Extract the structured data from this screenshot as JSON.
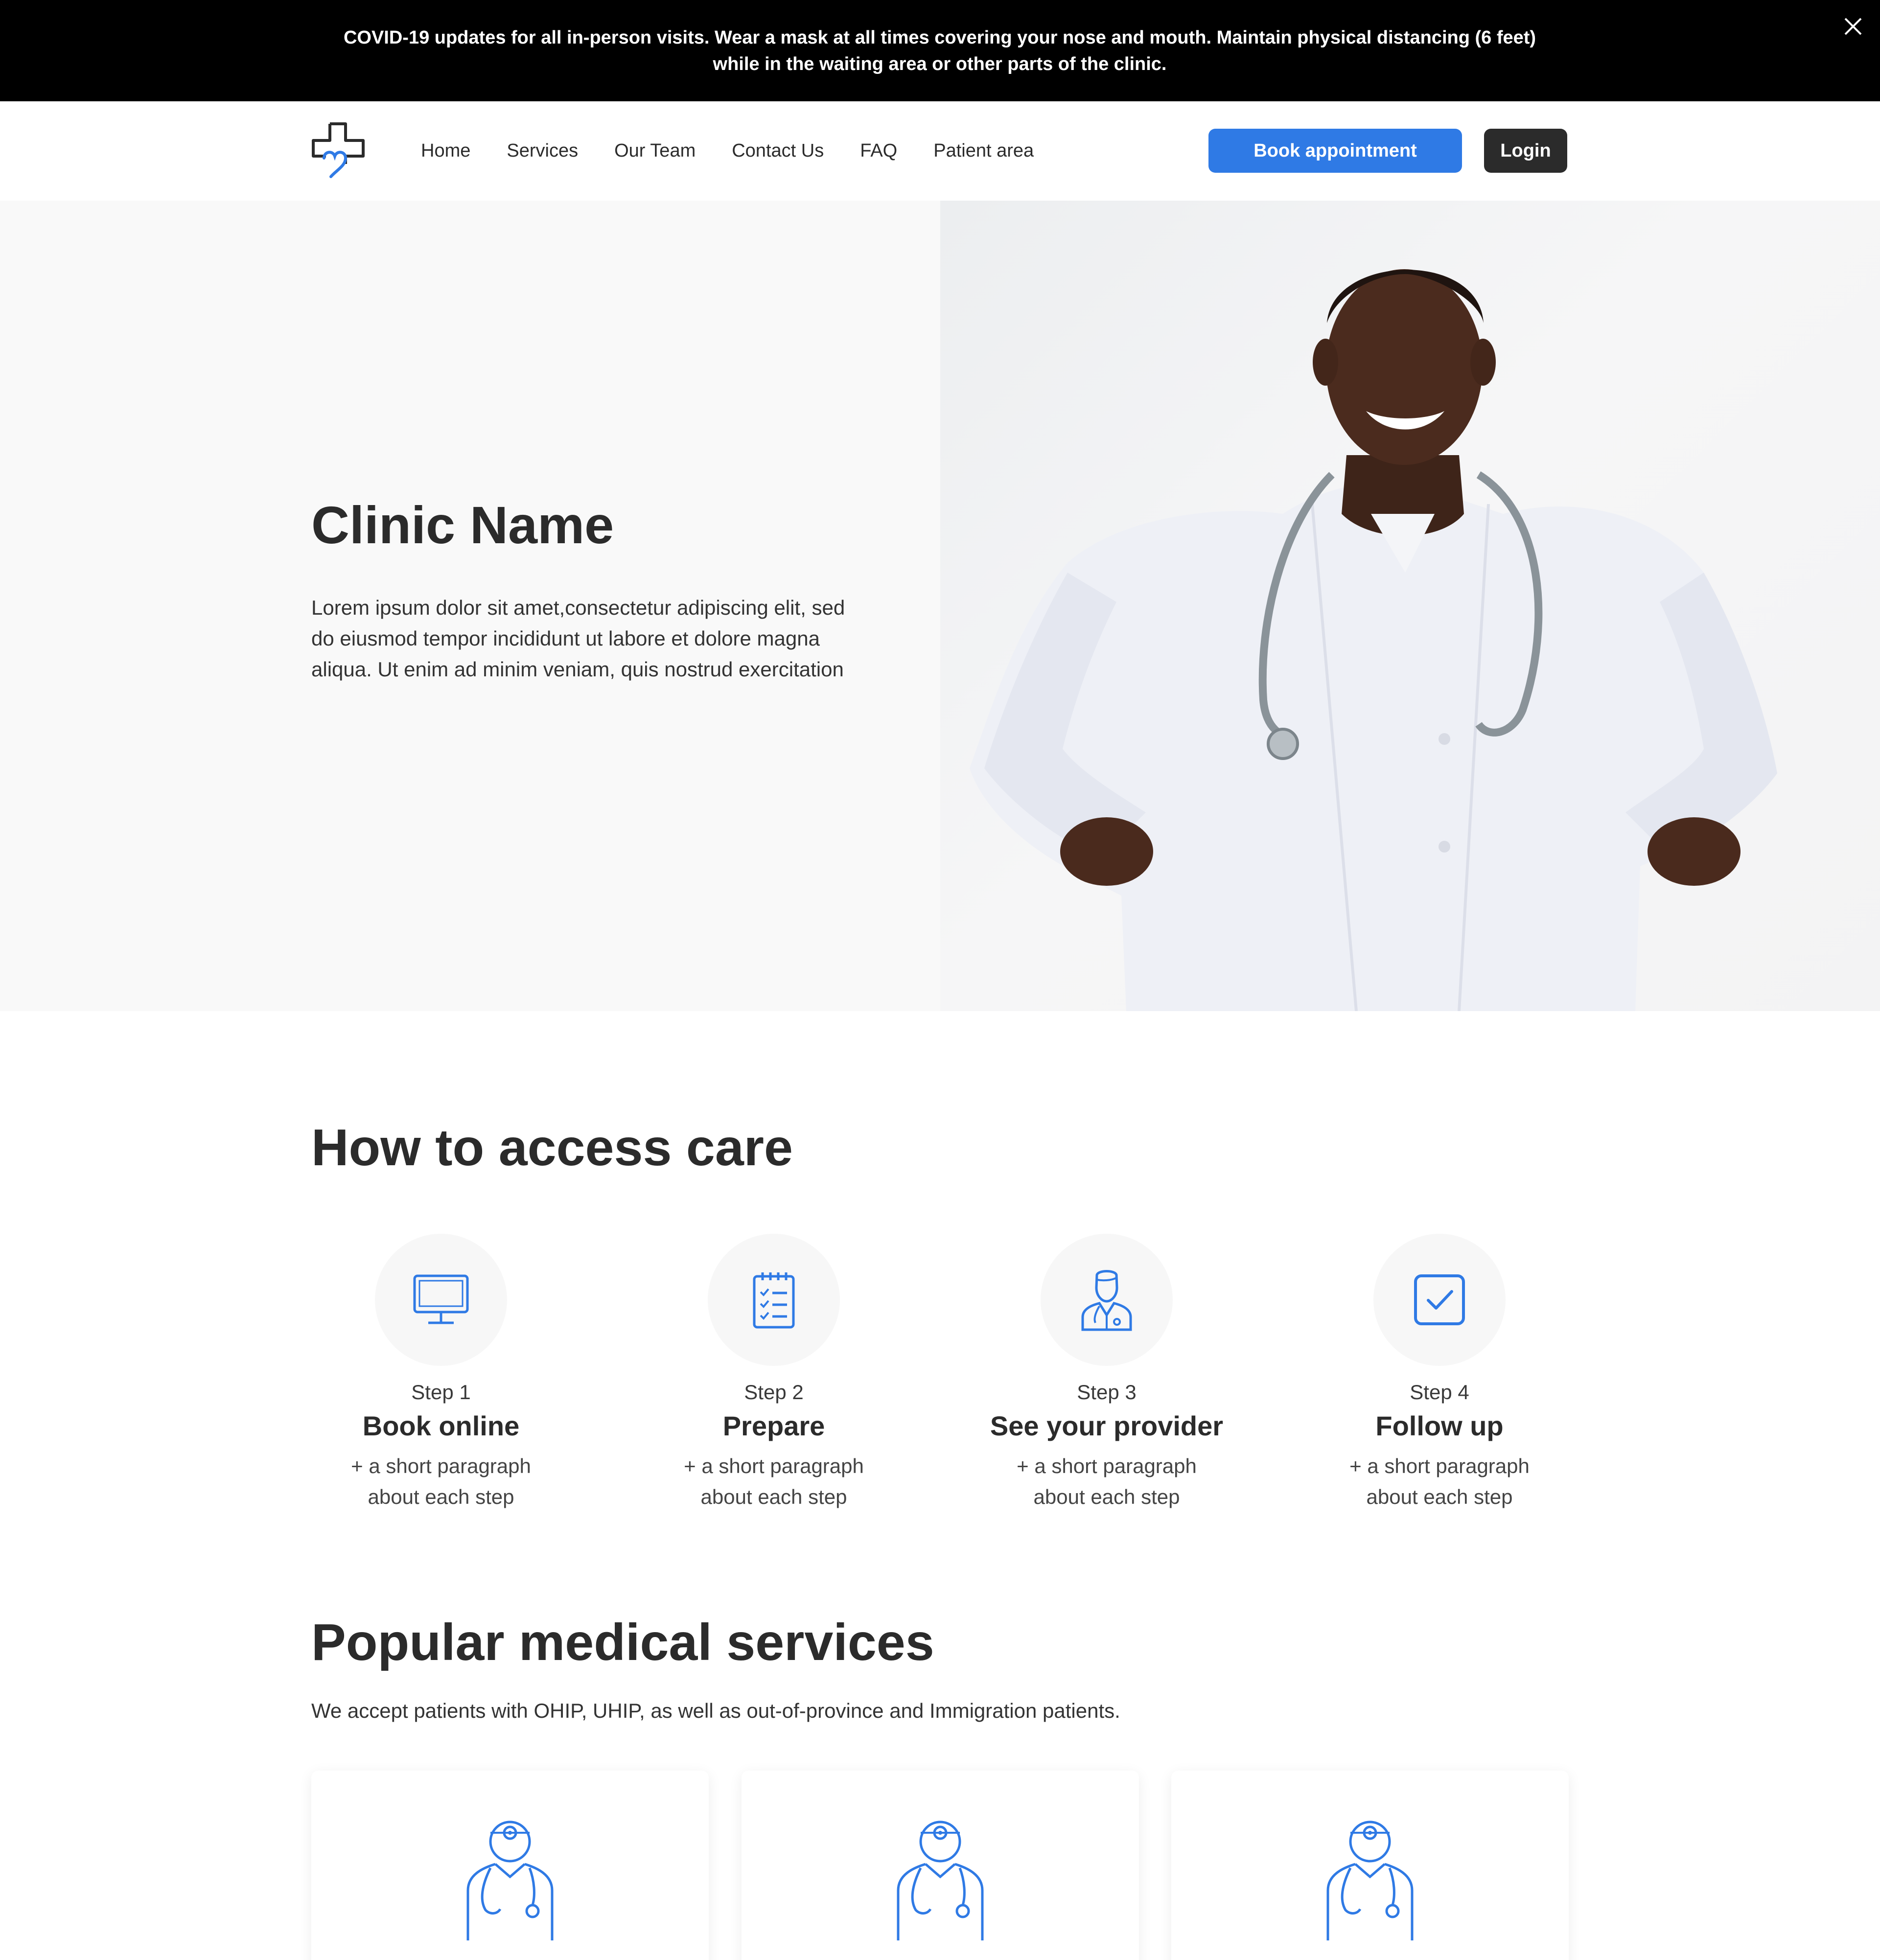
{
  "banner": {
    "text_line1": "COVID-19 updates for all in-person visits. Wear a mask at all times covering your nose and mouth. Maintain physical distancing (6 feet)",
    "text_line2": "while in the waiting area or other parts of the clinic.",
    "close_icon": "close-icon"
  },
  "header": {
    "logo_icon": "medical-cross-heart-icon",
    "nav": [
      "Home",
      "Services",
      "Our Team",
      "Contact Us",
      "FAQ",
      "Patient area"
    ],
    "book_label": "Book appointment",
    "login_label": "Login"
  },
  "hero": {
    "title": "Clinic Name",
    "text": "Lorem ipsum dolor sit amet,consectetur adipiscing elit, sed do eiusmod tempor incididunt ut labore et dolore magna aliqua. Ut enim ad minim veniam, quis nostrud exercitation",
    "photo_subject": "smiling doctor in white coat with stethoscope"
  },
  "care": {
    "title": "How to access care",
    "steps": [
      {
        "num": "Step 1",
        "title": "Book online",
        "desc": "+ a short paragraph about each step",
        "icon": "computer-monitor-icon"
      },
      {
        "num": "Step 2",
        "title": "Prepare",
        "desc": "+ a short paragraph about each step",
        "icon": "checklist-clipboard-icon"
      },
      {
        "num": "Step 3",
        "title": "See your provider",
        "desc": "+ a short paragraph about each step",
        "icon": "doctor-icon"
      },
      {
        "num": "Step 4",
        "title": "Follow up",
        "desc": "+ a short paragraph about each step",
        "icon": "checkbox-icon"
      }
    ]
  },
  "services": {
    "title": "Popular medical services",
    "subtitle": "We accept patients with OHIP, UHIP, as well as out-of-province and Immigration patients.",
    "cards": [
      {
        "icon": "physician-icon"
      },
      {
        "icon": "physician-icon"
      },
      {
        "icon": "physician-icon"
      }
    ]
  },
  "colors": {
    "accent": "#2f7ae5",
    "dark": "#2b2b2b",
    "banner_bg": "#000000",
    "hero_bg": "#f9f9f9"
  }
}
